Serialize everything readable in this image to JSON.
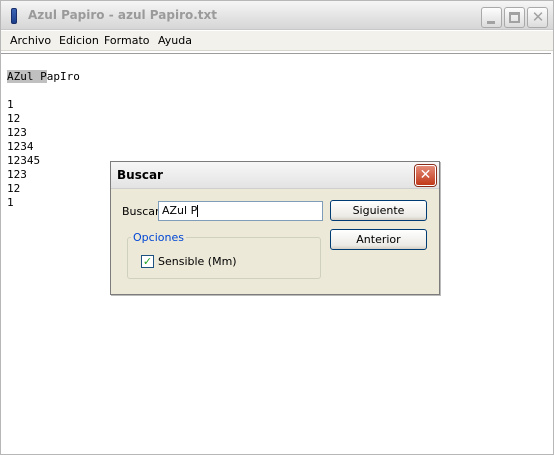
{
  "window": {
    "title": "Azul Papiro - azul Papiro.txt",
    "icons": {
      "minimize": "minimize-icon",
      "maximize": "maximize-icon",
      "close": "close-icon",
      "app": "app-icon"
    }
  },
  "menu": {
    "items": [
      "Archivo",
      "Edicion",
      "Formato",
      "Ayuda"
    ]
  },
  "editor": {
    "match": "AZul P",
    "rest": "apIro",
    "lines": [
      "1",
      "12",
      "123",
      "1234",
      "12345",
      "123",
      "12",
      "1"
    ]
  },
  "dialog": {
    "title": "Buscar",
    "search_label": "Buscar",
    "search_value": "AZul P",
    "next_button": "Siguiente",
    "prev_button": "Anterior",
    "options_legend": "Opciones",
    "case_sensitive_label": "Sensible (Mm)",
    "case_sensitive_checked": true
  }
}
